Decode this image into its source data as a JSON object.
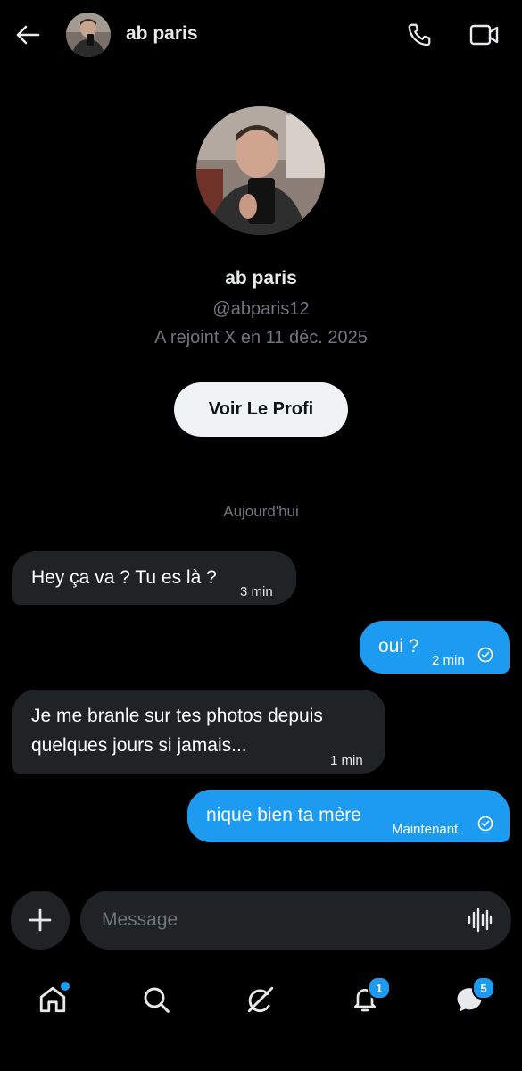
{
  "header": {
    "name": "ab paris"
  },
  "profile": {
    "name": "ab paris",
    "handle": "@abparis12",
    "joined": "A rejoint X en 11 déc. 2025",
    "view_button": "Voir Le Profi"
  },
  "date_separator": "Aujourd'hui",
  "messages": [
    {
      "direction": "incoming",
      "text": "Hey ça va ? Tu es là ?",
      "time": "3 min"
    },
    {
      "direction": "outgoing",
      "text": "oui ?",
      "time": "2 min",
      "status": "read"
    },
    {
      "direction": "incoming",
      "text": "Je me branle sur tes photos depuis quelques jours si jamais...",
      "time": "1 min"
    },
    {
      "direction": "outgoing",
      "text": "nique bien ta mère",
      "time": "Maintenant",
      "status": "read"
    }
  ],
  "composer": {
    "placeholder": "Message"
  },
  "nav": {
    "items": [
      {
        "icon": "home-icon",
        "has_dot": true
      },
      {
        "icon": "search-icon"
      },
      {
        "icon": "grok-icon"
      },
      {
        "icon": "bell-icon",
        "badge": "1"
      },
      {
        "icon": "messages-icon",
        "badge": "5"
      }
    ]
  },
  "colors": {
    "background": "#000000",
    "accent": "#1d9bf0",
    "incoming_bubble": "#1f2326",
    "muted_text": "#71767b"
  }
}
